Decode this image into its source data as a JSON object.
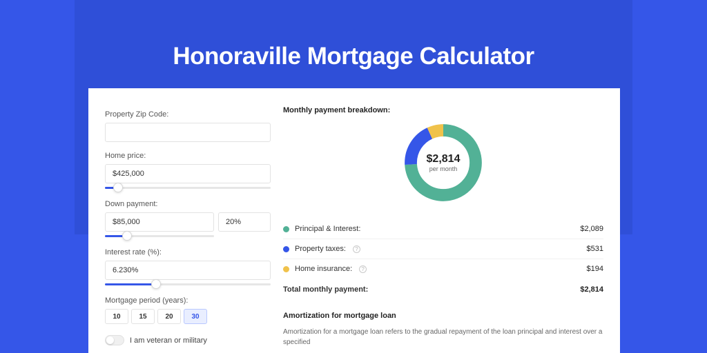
{
  "title": "Honoraville Mortgage Calculator",
  "form": {
    "zip_label": "Property Zip Code:",
    "zip_value": "",
    "home_price_label": "Home price:",
    "home_price_value": "$425,000",
    "home_price_slider_pct": 8,
    "down_label": "Down payment:",
    "down_value": "$85,000",
    "down_pct_value": "20%",
    "down_slider_pct": 20,
    "rate_label": "Interest rate (%):",
    "rate_value": "6.230%",
    "rate_slider_pct": 31,
    "period_label": "Mortgage period (years):",
    "periods": [
      "10",
      "15",
      "20",
      "30"
    ],
    "period_selected": "30",
    "veteran_label": "I am veteran or military"
  },
  "breakdown": {
    "title": "Monthly payment breakdown:",
    "center_amount": "$2,814",
    "center_sub": "per month",
    "items": [
      {
        "label": "Principal & Interest:",
        "value": "$2,089",
        "color": "#52b196",
        "info": false,
        "share": 74
      },
      {
        "label": "Property taxes:",
        "value": "$531",
        "color": "#3556e8",
        "info": true,
        "share": 19
      },
      {
        "label": "Home insurance:",
        "value": "$194",
        "color": "#f0c24b",
        "info": true,
        "share": 7
      }
    ],
    "total_label": "Total monthly payment:",
    "total_value": "$2,814"
  },
  "amort": {
    "title": "Amortization for mortgage loan",
    "body": "Amortization for a mortgage loan refers to the gradual repayment of the loan principal and interest over a specified"
  },
  "chart_data": {
    "type": "pie",
    "title": "Monthly payment breakdown",
    "series": [
      {
        "name": "Principal & Interest",
        "value": 2089,
        "color": "#52b196"
      },
      {
        "name": "Property taxes",
        "value": 531,
        "color": "#3556e8"
      },
      {
        "name": "Home insurance",
        "value": 194,
        "color": "#f0c24b"
      }
    ],
    "total": 2814,
    "center_label": "$2,814 per month"
  }
}
